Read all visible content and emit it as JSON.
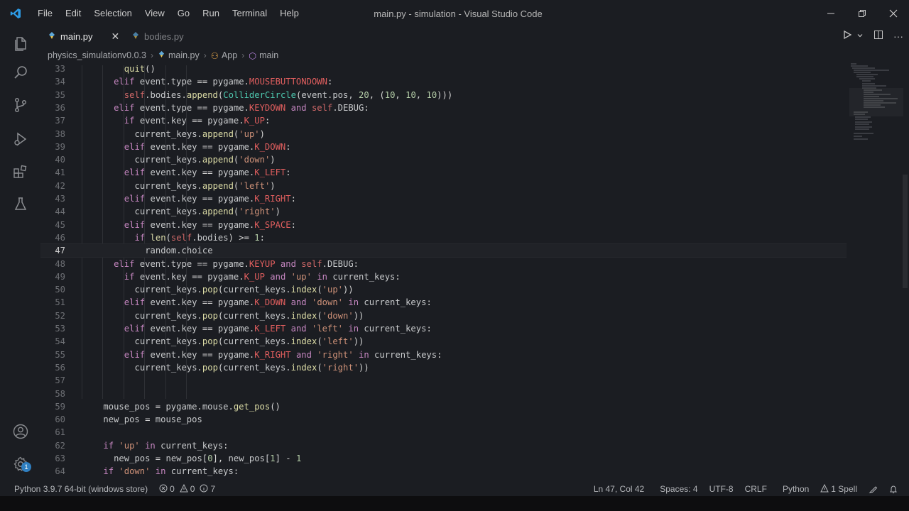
{
  "titlebar": {
    "menu": [
      "File",
      "Edit",
      "Selection",
      "View",
      "Go",
      "Run",
      "Terminal",
      "Help"
    ],
    "title": "main.py - simulation - Visual Studio Code"
  },
  "tabs": [
    {
      "label": "main.py",
      "active": true
    },
    {
      "label": "bodies.py",
      "active": false
    }
  ],
  "breadcrumb": [
    "physics_simulationv0.0.3",
    "main.py",
    "App",
    "main"
  ],
  "editor": {
    "current_line": 47,
    "lines": [
      {
        "n": "33",
        "indent": 8,
        "tokens": [
          [
            "fn",
            "quit"
          ],
          [
            "op",
            "()"
          ]
        ]
      },
      {
        "n": "34",
        "indent": 6,
        "tokens": [
          [
            "kw",
            "elif "
          ],
          [
            "vr",
            "event.type "
          ],
          [
            "op",
            "== "
          ],
          [
            "vr",
            "pygame."
          ],
          [
            "k",
            "MOUSEBUTTONDOWN"
          ],
          [
            "op",
            ":"
          ]
        ]
      },
      {
        "n": "35",
        "indent": 8,
        "tokens": [
          [
            "sf",
            "self"
          ],
          [
            "vr",
            ".bodies."
          ],
          [
            "fn",
            "append"
          ],
          [
            "op",
            "("
          ],
          [
            "cls",
            "ColliderCircle"
          ],
          [
            "op",
            "("
          ],
          [
            "vr",
            "event.pos, "
          ],
          [
            "nm",
            "20"
          ],
          [
            "op",
            ", ("
          ],
          [
            "nm",
            "10"
          ],
          [
            "op",
            ", "
          ],
          [
            "nm",
            "10"
          ],
          [
            "op",
            ", "
          ],
          [
            "nm",
            "10"
          ],
          [
            "op",
            ")))"
          ]
        ]
      },
      {
        "n": "36",
        "indent": 6,
        "tokens": [
          [
            "kw",
            "elif "
          ],
          [
            "vr",
            "event.type "
          ],
          [
            "op",
            "== "
          ],
          [
            "vr",
            "pygame."
          ],
          [
            "k",
            "KEYDOWN "
          ],
          [
            "kw",
            "and "
          ],
          [
            "sf",
            "self"
          ],
          [
            "vr",
            ".DEBUG"
          ],
          [
            "op",
            ":"
          ]
        ]
      },
      {
        "n": "37",
        "indent": 8,
        "tokens": [
          [
            "kw",
            "if "
          ],
          [
            "vr",
            "event.key "
          ],
          [
            "op",
            "== "
          ],
          [
            "vr",
            "pygame."
          ],
          [
            "k",
            "K_UP"
          ],
          [
            "op",
            ":"
          ]
        ]
      },
      {
        "n": "38",
        "indent": 10,
        "tokens": [
          [
            "vr",
            "current_keys."
          ],
          [
            "fn",
            "append"
          ],
          [
            "op",
            "("
          ],
          [
            "st",
            "'up'"
          ],
          [
            "op",
            ")"
          ]
        ]
      },
      {
        "n": "39",
        "indent": 8,
        "tokens": [
          [
            "kw",
            "elif "
          ],
          [
            "vr",
            "event.key "
          ],
          [
            "op",
            "== "
          ],
          [
            "vr",
            "pygame."
          ],
          [
            "k",
            "K_DOWN"
          ],
          [
            "op",
            ":"
          ]
        ]
      },
      {
        "n": "40",
        "indent": 10,
        "tokens": [
          [
            "vr",
            "current_keys."
          ],
          [
            "fn",
            "append"
          ],
          [
            "op",
            "("
          ],
          [
            "st",
            "'down'"
          ],
          [
            "op",
            ")"
          ]
        ]
      },
      {
        "n": "41",
        "indent": 8,
        "tokens": [
          [
            "kw",
            "elif "
          ],
          [
            "vr",
            "event.key "
          ],
          [
            "op",
            "== "
          ],
          [
            "vr",
            "pygame."
          ],
          [
            "k",
            "K_LEFT"
          ],
          [
            "op",
            ":"
          ]
        ]
      },
      {
        "n": "42",
        "indent": 10,
        "tokens": [
          [
            "vr",
            "current_keys."
          ],
          [
            "fn",
            "append"
          ],
          [
            "op",
            "("
          ],
          [
            "st",
            "'left'"
          ],
          [
            "op",
            ")"
          ]
        ]
      },
      {
        "n": "43",
        "indent": 8,
        "tokens": [
          [
            "kw",
            "elif "
          ],
          [
            "vr",
            "event.key "
          ],
          [
            "op",
            "== "
          ],
          [
            "vr",
            "pygame."
          ],
          [
            "k",
            "K_RIGHT"
          ],
          [
            "op",
            ":"
          ]
        ]
      },
      {
        "n": "44",
        "indent": 10,
        "tokens": [
          [
            "vr",
            "current_keys."
          ],
          [
            "fn",
            "append"
          ],
          [
            "op",
            "("
          ],
          [
            "st",
            "'right'"
          ],
          [
            "op",
            ")"
          ]
        ]
      },
      {
        "n": "45",
        "indent": 8,
        "tokens": [
          [
            "kw",
            "elif "
          ],
          [
            "vr",
            "event.key "
          ],
          [
            "op",
            "== "
          ],
          [
            "vr",
            "pygame."
          ],
          [
            "k",
            "K_SPACE"
          ],
          [
            "op",
            ":"
          ]
        ]
      },
      {
        "n": "46",
        "indent": 10,
        "tokens": [
          [
            "kw",
            "if "
          ],
          [
            "bi2",
            "len"
          ],
          [
            "op",
            "("
          ],
          [
            "sf",
            "self"
          ],
          [
            "vr",
            ".bodies"
          ],
          [
            "op",
            ") >= "
          ],
          [
            "nm",
            "1"
          ],
          [
            "op",
            ":"
          ]
        ]
      },
      {
        "n": "47",
        "indent": 12,
        "tokens": [
          [
            "vr",
            "random.choice"
          ]
        ]
      },
      {
        "n": "48",
        "indent": 6,
        "tokens": [
          [
            "kw",
            "elif "
          ],
          [
            "vr",
            "event.type "
          ],
          [
            "op",
            "== "
          ],
          [
            "vr",
            "pygame."
          ],
          [
            "k",
            "KEYUP "
          ],
          [
            "kw",
            "and "
          ],
          [
            "sf",
            "self"
          ],
          [
            "vr",
            ".DEBUG"
          ],
          [
            "op",
            ":"
          ]
        ]
      },
      {
        "n": "49",
        "indent": 8,
        "tokens": [
          [
            "kw",
            "if "
          ],
          [
            "vr",
            "event.key "
          ],
          [
            "op",
            "== "
          ],
          [
            "vr",
            "pygame."
          ],
          [
            "k",
            "K_UP "
          ],
          [
            "kw",
            "and "
          ],
          [
            "st",
            "'up' "
          ],
          [
            "kw",
            "in "
          ],
          [
            "vr",
            "current_keys"
          ],
          [
            "op",
            ":"
          ]
        ]
      },
      {
        "n": "50",
        "indent": 10,
        "tokens": [
          [
            "vr",
            "current_keys."
          ],
          [
            "fn",
            "pop"
          ],
          [
            "op",
            "("
          ],
          [
            "vr",
            "current_keys."
          ],
          [
            "fn",
            "index"
          ],
          [
            "op",
            "("
          ],
          [
            "st",
            "'up'"
          ],
          [
            "op",
            "))"
          ]
        ]
      },
      {
        "n": "51",
        "indent": 8,
        "tokens": [
          [
            "kw",
            "elif "
          ],
          [
            "vr",
            "event.key "
          ],
          [
            "op",
            "== "
          ],
          [
            "vr",
            "pygame."
          ],
          [
            "k",
            "K_DOWN "
          ],
          [
            "kw",
            "and "
          ],
          [
            "st",
            "'down' "
          ],
          [
            "kw",
            "in "
          ],
          [
            "vr",
            "current_keys"
          ],
          [
            "op",
            ":"
          ]
        ]
      },
      {
        "n": "52",
        "indent": 10,
        "tokens": [
          [
            "vr",
            "current_keys."
          ],
          [
            "fn",
            "pop"
          ],
          [
            "op",
            "("
          ],
          [
            "vr",
            "current_keys."
          ],
          [
            "fn",
            "index"
          ],
          [
            "op",
            "("
          ],
          [
            "st",
            "'down'"
          ],
          [
            "op",
            "))"
          ]
        ]
      },
      {
        "n": "53",
        "indent": 8,
        "tokens": [
          [
            "kw",
            "elif "
          ],
          [
            "vr",
            "event.key "
          ],
          [
            "op",
            "== "
          ],
          [
            "vr",
            "pygame."
          ],
          [
            "k",
            "K_LEFT "
          ],
          [
            "kw",
            "and "
          ],
          [
            "st",
            "'left' "
          ],
          [
            "kw",
            "in "
          ],
          [
            "vr",
            "current_keys"
          ],
          [
            "op",
            ":"
          ]
        ]
      },
      {
        "n": "54",
        "indent": 10,
        "tokens": [
          [
            "vr",
            "current_keys."
          ],
          [
            "fn",
            "pop"
          ],
          [
            "op",
            "("
          ],
          [
            "vr",
            "current_keys."
          ],
          [
            "fn",
            "index"
          ],
          [
            "op",
            "("
          ],
          [
            "st",
            "'left'"
          ],
          [
            "op",
            "))"
          ]
        ]
      },
      {
        "n": "55",
        "indent": 8,
        "tokens": [
          [
            "kw",
            "elif "
          ],
          [
            "vr",
            "event.key "
          ],
          [
            "op",
            "== "
          ],
          [
            "vr",
            "pygame."
          ],
          [
            "k",
            "K_RIGHT "
          ],
          [
            "kw",
            "and "
          ],
          [
            "st",
            "'right' "
          ],
          [
            "kw",
            "in "
          ],
          [
            "vr",
            "current_keys"
          ],
          [
            "op",
            ":"
          ]
        ]
      },
      {
        "n": "56",
        "indent": 10,
        "tokens": [
          [
            "vr",
            "current_keys."
          ],
          [
            "fn",
            "pop"
          ],
          [
            "op",
            "("
          ],
          [
            "vr",
            "current_keys."
          ],
          [
            "fn",
            "index"
          ],
          [
            "op",
            "("
          ],
          [
            "st",
            "'right'"
          ],
          [
            "op",
            "))"
          ]
        ]
      },
      {
        "n": "57",
        "indent": 0,
        "tokens": []
      },
      {
        "n": "58",
        "indent": 0,
        "tokens": []
      },
      {
        "n": "59",
        "indent": 4,
        "tokens": [
          [
            "vr",
            "mouse_pos "
          ],
          [
            "op",
            "= "
          ],
          [
            "vr",
            "pygame.mouse."
          ],
          [
            "fn",
            "get_pos"
          ],
          [
            "op",
            "()"
          ]
        ]
      },
      {
        "n": "60",
        "indent": 4,
        "tokens": [
          [
            "vr",
            "new_pos "
          ],
          [
            "op",
            "= "
          ],
          [
            "vr",
            "mouse_pos"
          ]
        ]
      },
      {
        "n": "61",
        "indent": 0,
        "tokens": []
      },
      {
        "n": "62",
        "indent": 4,
        "tokens": [
          [
            "kw",
            "if "
          ],
          [
            "st",
            "'up' "
          ],
          [
            "kw",
            "in "
          ],
          [
            "vr",
            "current_keys"
          ],
          [
            "op",
            ":"
          ]
        ]
      },
      {
        "n": "63",
        "indent": 6,
        "tokens": [
          [
            "vr",
            "new_pos "
          ],
          [
            "op",
            "= "
          ],
          [
            "vr",
            "new_pos["
          ],
          [
            "nm",
            "0"
          ],
          [
            "op",
            "], "
          ],
          [
            "vr",
            "new_pos["
          ],
          [
            "nm",
            "1"
          ],
          [
            "op",
            "] - "
          ],
          [
            "nm",
            "1"
          ]
        ]
      },
      {
        "n": "64",
        "indent": 4,
        "tokens": [
          [
            "kw",
            "if "
          ],
          [
            "st",
            "'down' "
          ],
          [
            "kw",
            "in "
          ],
          [
            "vr",
            "current_keys"
          ],
          [
            "op",
            ":"
          ]
        ]
      }
    ]
  },
  "statusbar": {
    "python": "Python 3.9.7 64-bit (windows store)",
    "errors": "0",
    "warnings": "0",
    "info": "7",
    "position": "Ln 47, Col 42",
    "spaces": "Spaces: 4",
    "encoding": "UTF-8",
    "eol": "CRLF",
    "language": "Python",
    "spell": "1 Spell"
  },
  "colors": {
    "accent": "#2f7fc1",
    "background": "#1b1d22",
    "keyword": "#c586c0",
    "string": "#ce9178"
  }
}
